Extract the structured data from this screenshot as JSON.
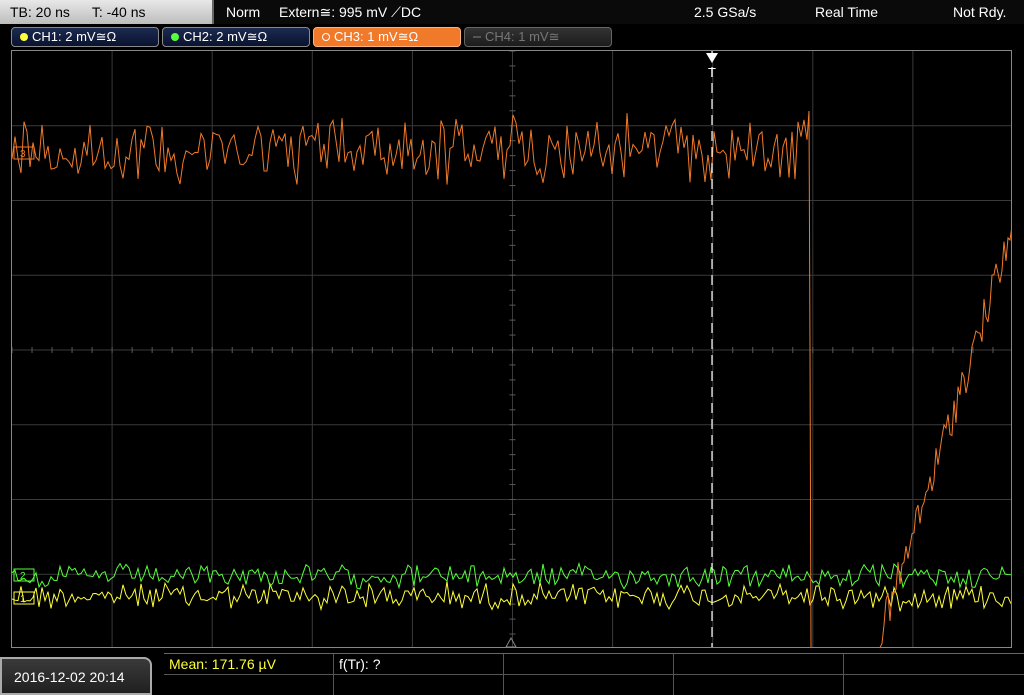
{
  "topbar": {
    "timebase": "TB: 20 ns",
    "trigger_pos": "T: -40 ns",
    "mode": "Norm",
    "trigger_source": "Extern≅: 995 mV ⟋DC",
    "sample_rate": "2.5 GSa/s",
    "acq_mode": "Real Time",
    "state": "Not Rdy."
  },
  "channels": [
    {
      "label": "CH1: 2 mV≅Ω",
      "color": "#ffff3a"
    },
    {
      "label": "CH2: 2 mV≅Ω",
      "color": "#55ff3a"
    },
    {
      "label": "CH3: 1 mV≅Ω",
      "color": "#f07a2a"
    },
    {
      "label": "CH4: 1 mV≅",
      "color": "#777777"
    }
  ],
  "plot": {
    "trigger_marker": "T",
    "ch_marker_3": "3",
    "ch_marker_2": "2",
    "ch_marker_1": "1"
  },
  "bottom": {
    "datetime": "2016-12-02 20:14",
    "mean": "Mean: 171.76 µV",
    "freq": "f(Tr): ?"
  },
  "colors": {
    "ch1": "#ffff3a",
    "ch2": "#55ff3a",
    "ch3": "#f07a2a",
    "grid": "#3a3a3a"
  }
}
